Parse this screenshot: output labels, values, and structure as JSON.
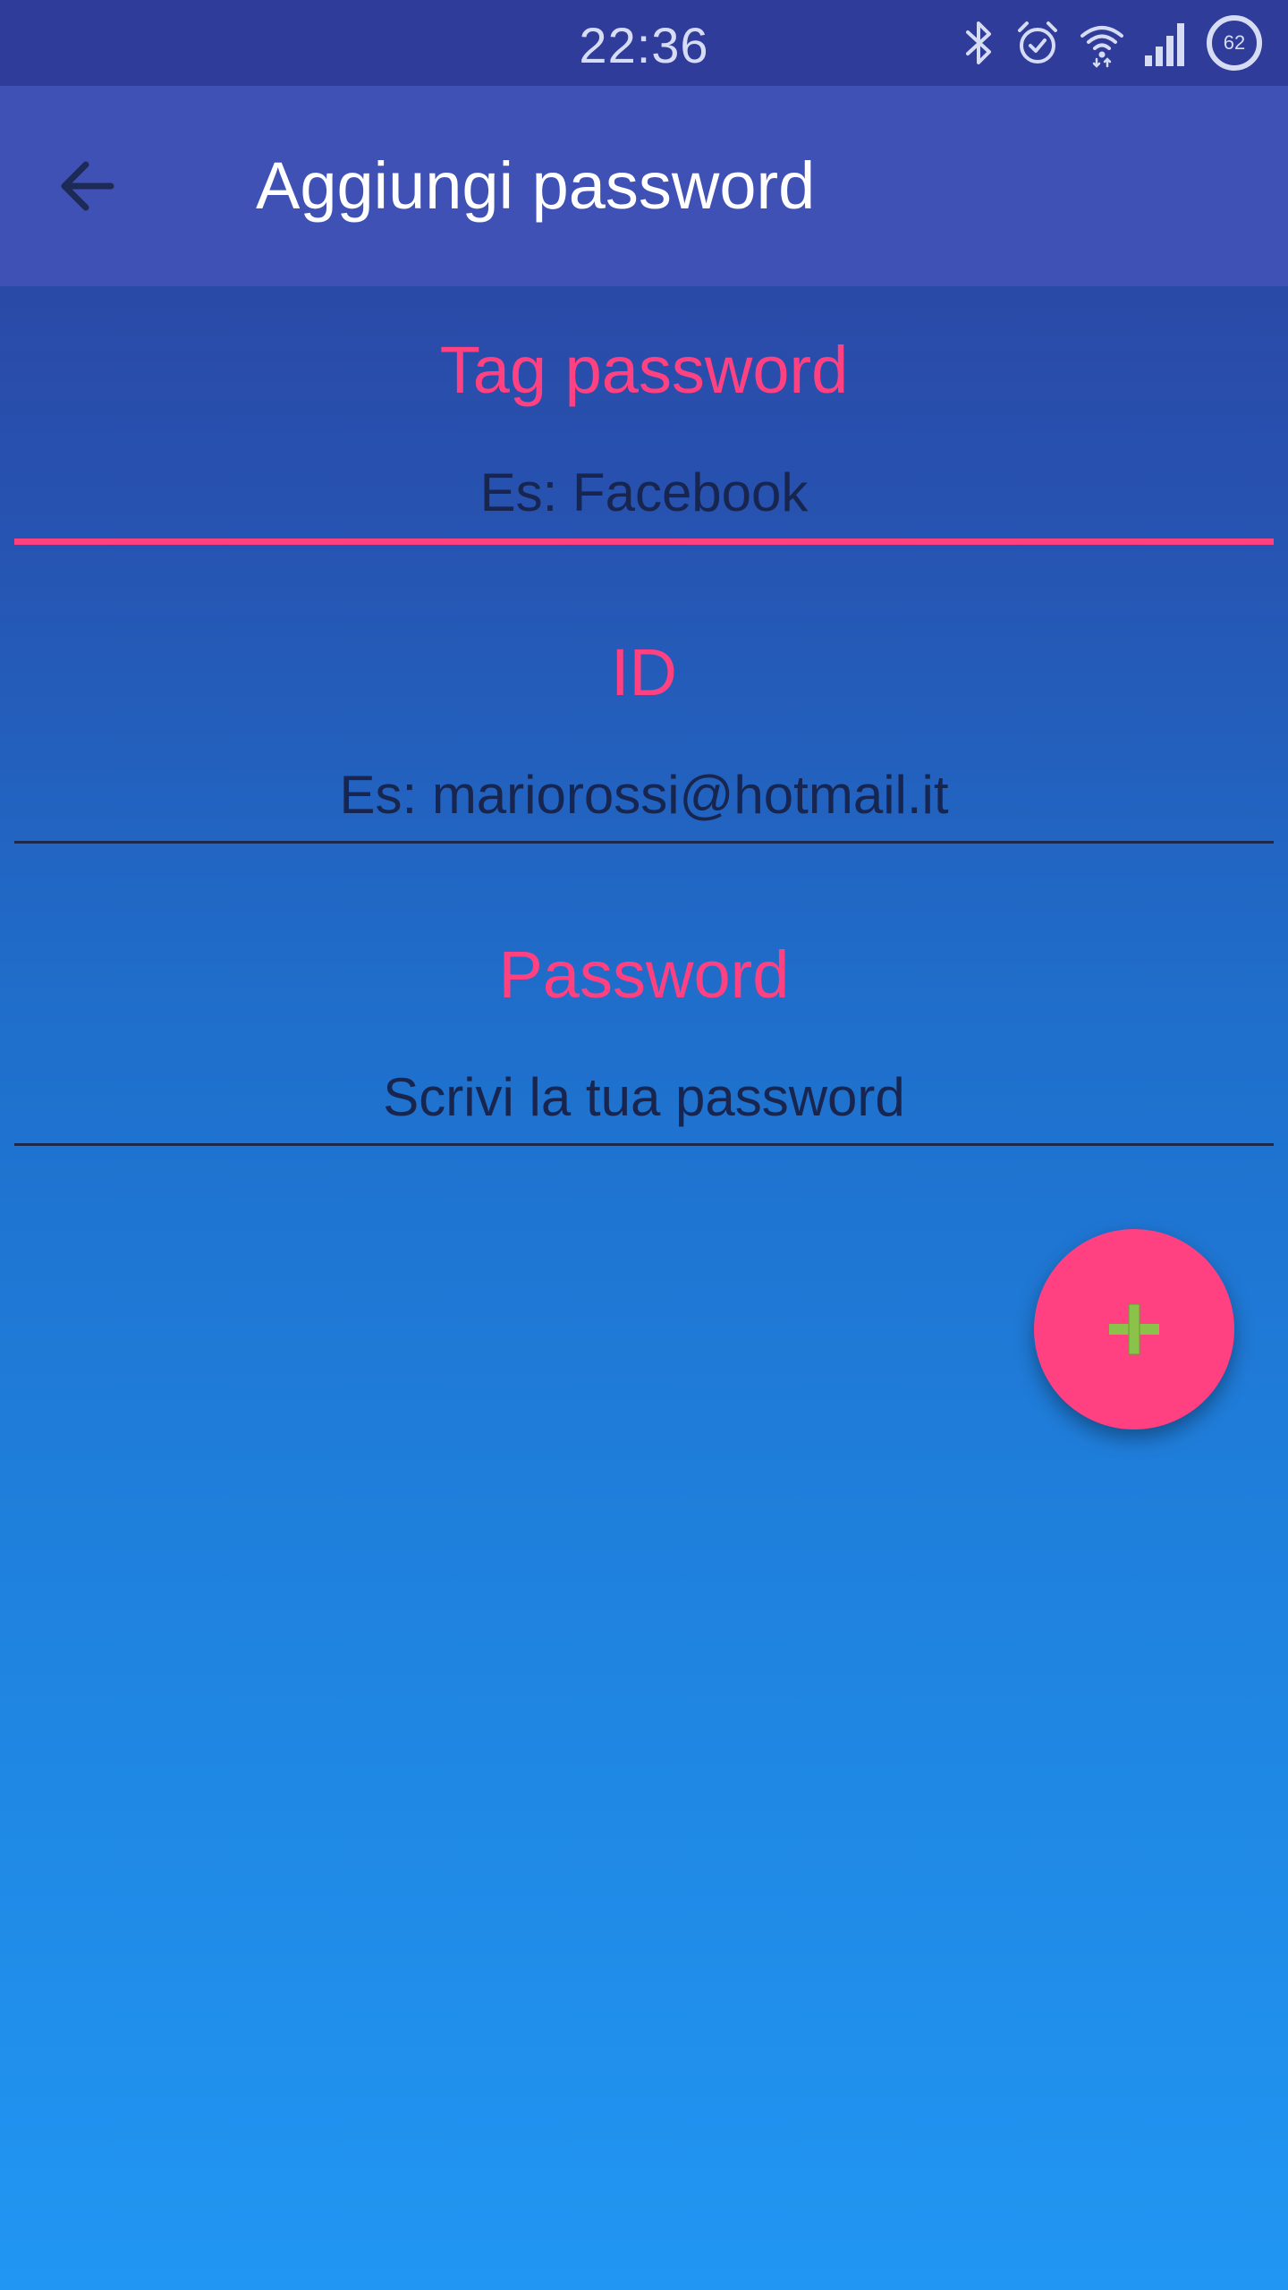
{
  "status_bar": {
    "time": "22:36",
    "battery_level": "62",
    "icons": [
      "bluetooth-icon",
      "alarm-icon",
      "wifi-icon",
      "signal-icon",
      "battery-icon"
    ]
  },
  "app_bar": {
    "title": "Aggiungi password",
    "back_icon": "arrow-back-icon"
  },
  "form": {
    "tag": {
      "label": "Tag password",
      "placeholder": "Es: Facebook",
      "value": ""
    },
    "id": {
      "label": "ID",
      "placeholder": "Es: mariorossi@hotmail.it",
      "value": ""
    },
    "password": {
      "label": "Password",
      "placeholder": "Scrivi la tua password",
      "value": ""
    }
  },
  "fab": {
    "icon": "plus-icon"
  },
  "colors": {
    "primary": "#3f51b5",
    "primary_dark": "#2f3c9a",
    "accent": "#ff4081",
    "fab_icon": "#8bc34a"
  }
}
